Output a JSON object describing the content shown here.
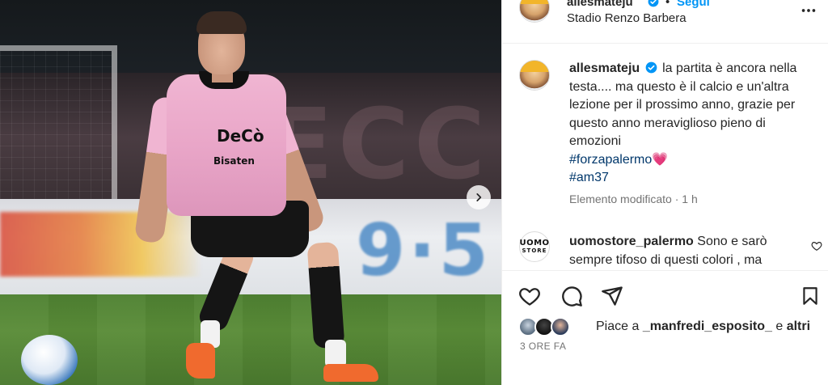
{
  "post": {
    "username": "allesmateju",
    "follow_label": "Segui",
    "dot": "•",
    "location": "Stadio Renzo Barbera",
    "caption_text": "la partita è ancora nella testa.... ma questo è il calcio e un'altra lezione per il prossimo anno, grazie per questo anno meraviglioso pieno di emozioni",
    "hashtag_1": "#forzapalermo💗",
    "hashtag_2": "#am37",
    "edited_label": "Elemento modificato · 1 h",
    "verified_color": "#0095f6"
  },
  "comment": {
    "username": "uomostore_palermo",
    "text": "Sono e sarò sempre tifoso di questi colori , ma",
    "avatar_line1": "UOMO",
    "avatar_line2": "STORE"
  },
  "likes": {
    "prefix": "Piace a",
    "user": "_manfredi_esposito_",
    "joiner": "e",
    "others": "altri"
  },
  "timestamp": "3 ORE FA",
  "media": {
    "jersey_sponsor": "DeCò",
    "jersey_sponsor_2": "Bisaten",
    "board_text": "9·5",
    "wall_text": "ECC"
  },
  "icons": {
    "like": "heart-icon",
    "comment": "comment-icon",
    "share": "share-icon",
    "save": "bookmark-icon",
    "more": "more-options-icon",
    "next": "chevron-right-icon"
  },
  "colors": {
    "link": "#0095f6",
    "hashtag": "#00376b",
    "secondary": "#737373",
    "jersey": "#f0b5d2"
  }
}
